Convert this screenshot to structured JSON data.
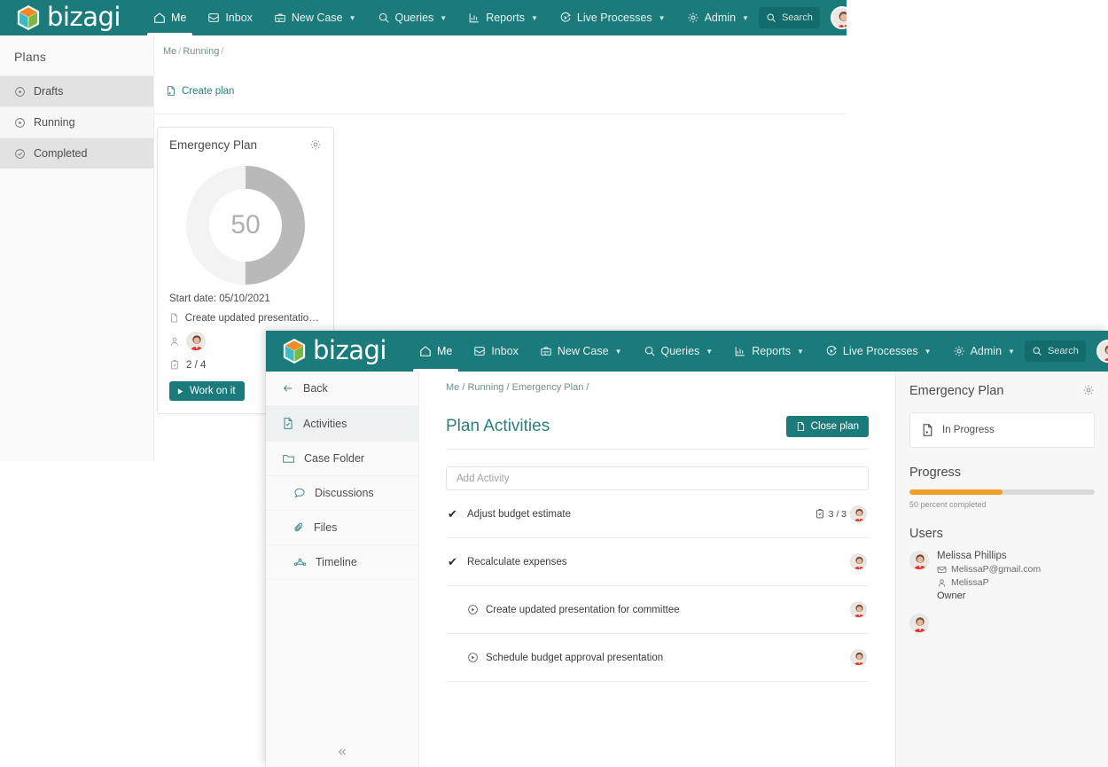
{
  "brand": {
    "name": "bizagi",
    "teal": "#1b7b7b",
    "accent_orange": "#f0a028"
  },
  "navbar": {
    "items": [
      {
        "label": "Me",
        "icon": "home-icon",
        "active": true,
        "caret": false
      },
      {
        "label": "Inbox",
        "icon": "inbox-icon",
        "active": false,
        "caret": false
      },
      {
        "label": "New Case",
        "icon": "briefcase-plus-icon",
        "active": false,
        "caret": true
      },
      {
        "label": "Queries",
        "icon": "search-icon",
        "active": false,
        "caret": true
      },
      {
        "label": "Reports",
        "icon": "chart-icon",
        "active": false,
        "caret": true
      },
      {
        "label": "Live Processes",
        "icon": "live-processes-icon",
        "active": false,
        "caret": true
      },
      {
        "label": "Admin",
        "icon": "gear-icon",
        "active": false,
        "caret": true
      }
    ],
    "search_placeholder": "Search"
  },
  "window1": {
    "sidebar": {
      "title": "Plans",
      "items": [
        {
          "label": "Drafts",
          "icon": "circle-dot-icon"
        },
        {
          "label": "Running",
          "icon": "play-circle-icon"
        },
        {
          "label": "Completed",
          "icon": "check-circle-icon"
        }
      ]
    },
    "breadcrumb": [
      "Me",
      "Running"
    ],
    "create_plan_label": "Create plan",
    "plan_card": {
      "title": "Emergency Plan",
      "gear_icon": "gear-icon",
      "progress_value": "50",
      "progress_percent": 50,
      "start_date_label": "Start date: 05/10/2021",
      "next_task": "Create updated presentation for...",
      "task_count": "2 / 4",
      "work_button": "Work on it"
    }
  },
  "window2": {
    "sidebar": {
      "items": [
        {
          "label": "Back",
          "icon": "arrow-left-icon",
          "active": false,
          "sub": false
        },
        {
          "label": "Activities",
          "icon": "document-check-icon",
          "active": true,
          "sub": false
        },
        {
          "label": "Case Folder",
          "icon": "folder-icon",
          "active": false,
          "sub": false
        },
        {
          "label": "Discussions",
          "icon": "chat-bubble-icon",
          "active": false,
          "sub": true
        },
        {
          "label": "Files",
          "icon": "paperclip-icon",
          "active": false,
          "sub": true
        },
        {
          "label": "Timeline",
          "icon": "timeline-icon",
          "active": false,
          "sub": true
        }
      ],
      "collapse_icon": "chevron-double-left-icon"
    },
    "breadcrumb": [
      "Me",
      "Running",
      "Emergency Plan"
    ],
    "page_title": "Plan Activities",
    "close_plan_label": "Close plan",
    "add_activity_placeholder": "Add Activity",
    "activities": [
      {
        "label": "Adjust budget estimate",
        "state": "done",
        "state_icon": "check-icon",
        "count": "3 / 3",
        "count_icon": "clipboard-check-icon"
      },
      {
        "label": "Recalculate expenses",
        "state": "done",
        "state_icon": "check-icon",
        "count": "",
        "count_icon": ""
      },
      {
        "label": "Create updated presentation for committee",
        "state": "pending",
        "state_icon": "play-circle-icon",
        "count": "",
        "count_icon": ""
      },
      {
        "label": "Schedule budget approval presentation",
        "state": "pending",
        "state_icon": "play-circle-icon",
        "count": "",
        "count_icon": ""
      }
    ],
    "panel_tab_icon": "chevron-right-icon",
    "right_panel": {
      "title": "Emergency Plan",
      "gear_icon": "gear-icon",
      "status_label": "In Progress",
      "status_icon": "document-play-icon",
      "progress_heading": "Progress",
      "progress_percent": 50,
      "progress_caption": "50 percent completed",
      "users_heading": "Users",
      "users": [
        {
          "name": "Melissa Phillips",
          "email": "MelissaP@gmail.com",
          "username": "MelissaP",
          "role": "Owner"
        }
      ]
    }
  }
}
